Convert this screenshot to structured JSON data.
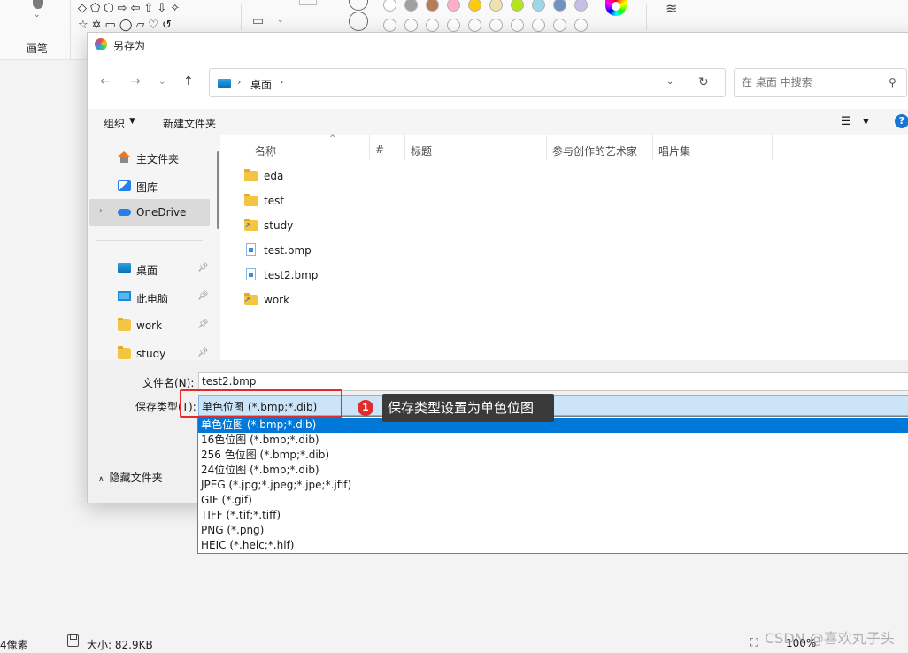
{
  "ribbon": {
    "brush_label": "画笔",
    "shapes_row1": "◇⬠⬡⇨⇦⇧⇩✧",
    "shapes_row2": "☆✡▭◯▱♡↺",
    "swatch_colors": [
      "#ffffff",
      "#a0a0a0",
      "#b97a57",
      "#ffaec9",
      "#ffc90e",
      "#efe4b0",
      "#b5e61d",
      "#99d9ea",
      "#7092be",
      "#c8bfe7"
    ]
  },
  "dialog": {
    "title": "另存为",
    "breadcrumb": "桌面",
    "search_placeholder": "在 桌面 中搜索",
    "toolbar": {
      "organize": "组织",
      "new_folder": "新建文件夹"
    },
    "sidebar": [
      {
        "label": "主文件夹",
        "icon": "home-icon"
      },
      {
        "label": "图库",
        "icon": "gallery-icon"
      },
      {
        "label": "OneDrive",
        "icon": "cloud-icon"
      },
      {
        "label": "桌面",
        "icon": "desktop-icon"
      },
      {
        "label": "此电脑",
        "icon": "pc-icon"
      },
      {
        "label": "work",
        "icon": "folder-icon"
      },
      {
        "label": "study",
        "icon": "folder-icon"
      }
    ],
    "columns": [
      "名称",
      "#",
      "标题",
      "参与创作的艺术家",
      "唱片集"
    ],
    "files": [
      {
        "name": "eda",
        "type": "folder"
      },
      {
        "name": "test",
        "type": "folder"
      },
      {
        "name": "study",
        "type": "folder-shortcut"
      },
      {
        "name": "test.bmp",
        "type": "bmp"
      },
      {
        "name": "test2.bmp",
        "type": "bmp"
      },
      {
        "name": "work",
        "type": "folder-shortcut"
      }
    ],
    "filename_label": "文件名(N):",
    "filename_value": "test2.bmp",
    "filetype_label": "保存类型(T):",
    "filetype_value": "单色位图 (*.bmp;*.dib)",
    "hide_folders": "隐藏文件夹",
    "filetype_options": [
      "单色位图 (*.bmp;*.dib)",
      "16色位图 (*.bmp;*.dib)",
      "256 色位图 (*.bmp;*.dib)",
      "24位位图 (*.bmp;*.dib)",
      "JPEG (*.jpg;*.jpeg;*.jpe;*.jfif)",
      "GIF (*.gif)",
      "TIFF (*.tif;*.tiff)",
      "PNG (*.png)",
      "HEIC (*.heic;*.hif)"
    ]
  },
  "annotation": {
    "number": "1",
    "text": "保存类型设置为单色位图"
  },
  "statusbar": {
    "pixels": "4像素",
    "size": "大小: 82.9KB",
    "zoom": "100%"
  },
  "watermark": "CSDN @喜欢丸子头",
  "colors": {
    "accent": "#0078d7",
    "annotation_red": "#e32b2b",
    "selection_bg": "#cce4f7"
  }
}
